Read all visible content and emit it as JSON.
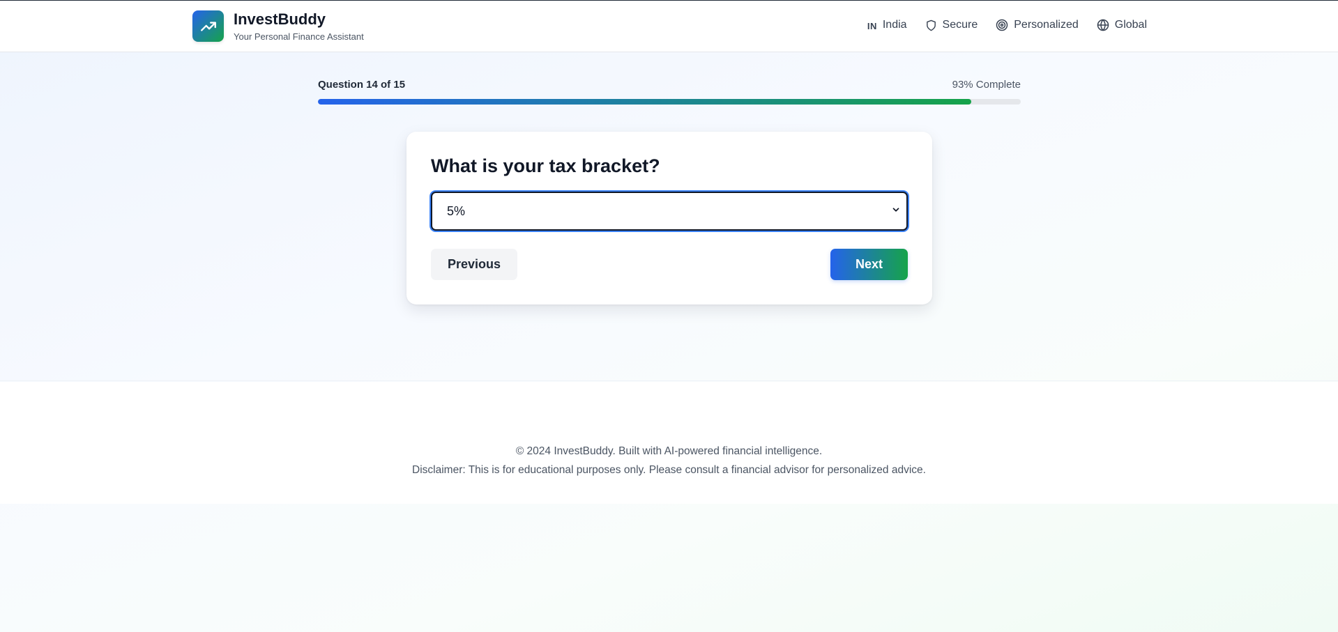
{
  "header": {
    "brand_title": "InvestBuddy",
    "brand_subtitle": "Your Personal Finance Assistant",
    "nav": {
      "country_code": "IN",
      "country": "India",
      "secure": "Secure",
      "personalized": "Personalized",
      "global": "Global"
    }
  },
  "progress": {
    "question_label": "Question 14 of 15",
    "complete_label": "93% Complete",
    "fraction": 0.93
  },
  "question": {
    "title": "What is your tax bracket?",
    "selected_value": "5%"
  },
  "buttons": {
    "previous": "Previous",
    "next": "Next"
  },
  "footer": {
    "line1": "© 2024 InvestBuddy. Built with AI-powered financial intelligence.",
    "line2": "Disclaimer: This is for educational purposes only. Please consult a financial advisor for personalized advice."
  },
  "colors": {
    "brand_blue": "#2563eb",
    "brand_green": "#16a34a"
  },
  "icons": {
    "logo": "trending-up-icon",
    "secure": "shield-icon",
    "personalized": "target-icon",
    "global": "globe-icon",
    "select": "chevron-down-icon"
  }
}
